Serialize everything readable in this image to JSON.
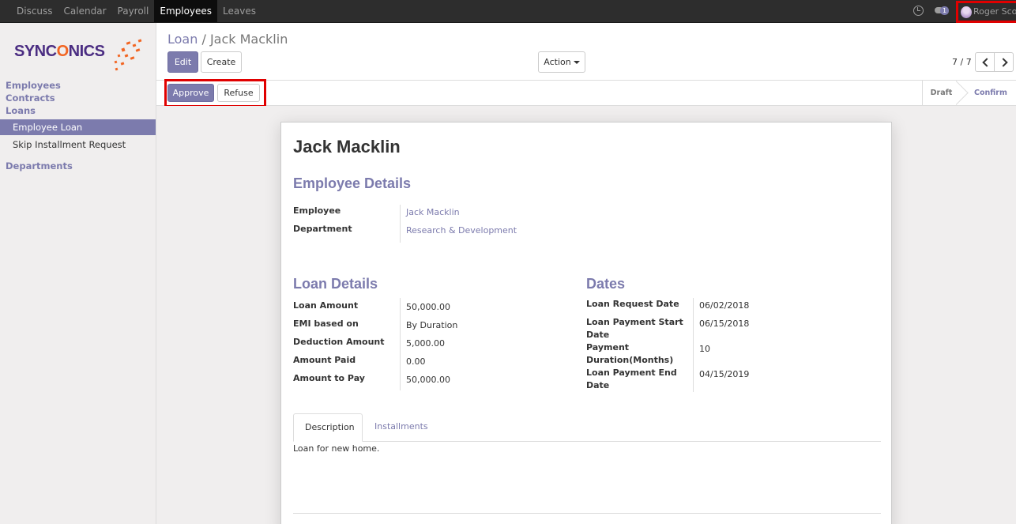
{
  "nav": {
    "items": [
      "Discuss",
      "Calendar",
      "Payroll",
      "Employees",
      "Leaves"
    ],
    "active_index": 3,
    "message_count": "1",
    "user_name": "Roger Scott"
  },
  "sidebar": {
    "logo_text": {
      "before": "SYNC",
      "o": "O",
      "after": "NICS"
    },
    "sections": [
      "Employees",
      "Contracts",
      "Loans"
    ],
    "items": [
      "Employee Loan",
      "Skip Installment Request"
    ],
    "active_item": "Employee Loan",
    "footer_section": "Departments"
  },
  "control": {
    "breadcrumb_parent": "Loan",
    "breadcrumb_sep": "/",
    "breadcrumb_current": "Jack Macklin",
    "edit_label": "Edit",
    "create_label": "Create",
    "action_label": "Action",
    "pager": "7 / 7"
  },
  "statusbar": {
    "approve_label": "Approve",
    "refuse_label": "Refuse",
    "stages": [
      "Draft",
      "Confirm"
    ],
    "current_stage": "Confirm"
  },
  "form": {
    "name": "Jack Macklin",
    "employee_details": {
      "heading": "Employee Details",
      "employee_label": "Employee",
      "employee_value": "Jack Macklin",
      "department_label": "Department",
      "department_value": "Research & Development"
    },
    "loan_details": {
      "heading": "Loan Details",
      "fields": [
        {
          "label": "Loan Amount",
          "value": "50,000.00"
        },
        {
          "label": "EMI based on",
          "value": "By Duration"
        },
        {
          "label": "Deduction Amount",
          "value": "5,000.00"
        },
        {
          "label": "Amount Paid",
          "value": "0.00"
        },
        {
          "label": "Amount to Pay",
          "value": "50,000.00"
        }
      ]
    },
    "dates": {
      "heading": "Dates",
      "fields": [
        {
          "label_l1": "Loan Request Date",
          "label_l2": "",
          "value": "06/02/2018"
        },
        {
          "label_l1": "Loan Payment Start",
          "label_l2": "Date",
          "value": "06/15/2018"
        },
        {
          "label_l1": "Payment",
          "label_l2": "Duration(Months)",
          "value": "10"
        },
        {
          "label_l1": "Loan Payment End",
          "label_l2": "Date",
          "value": "04/15/2019"
        }
      ]
    },
    "tabs": [
      "Description",
      "Installments"
    ],
    "description": "Loan for new home."
  },
  "colors": {
    "accent": "#7c7bad",
    "highlight": "#e00000",
    "navbar": "#2d2d2d"
  }
}
